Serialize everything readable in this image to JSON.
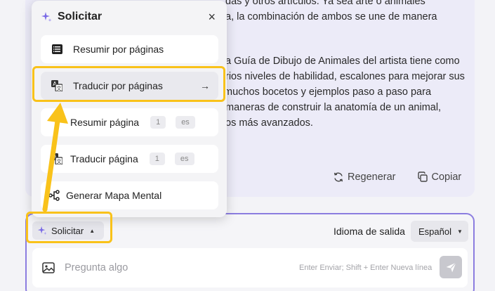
{
  "answer": {
    "lines": [
      "das y otros artículos. Ya sea arte o animales",
      "a, la combinación de ambos se une de manera",
      "",
      "a Guía de Dibujo de Animales del artista tiene como",
      "rios niveles de habilidad, escalones para mejorar sus",
      "muchos bocetos y ejemplos paso a paso para",
      "maneras de construir la anatomía de un animal,",
      "os más avanzados."
    ],
    "regenerate_label": "Regenerar",
    "copy_label": "Copiar"
  },
  "dropdown": {
    "title": "Solicitar",
    "close_label": "×",
    "items": [
      {
        "label": "Resumir por páginas",
        "icon": "list-icon"
      },
      {
        "label": "Traducir por páginas",
        "icon": "translate-icon",
        "arrow": "→"
      },
      {
        "label": "Resumir página",
        "icon": "list-icon",
        "page": "1",
        "lang": "es"
      },
      {
        "label": "Traducir página",
        "icon": "translate-icon",
        "page": "1",
        "lang": "es"
      },
      {
        "label": "Generar Mapa Mental",
        "icon": "mind-map-icon"
      }
    ]
  },
  "input": {
    "solicitar_label": "Solicitar",
    "output_language_label": "Idioma de salida",
    "output_language_value": "Español",
    "placeholder": "Pregunta algo",
    "hint": "Enter Enviar; Shift + Enter Nueva línea"
  },
  "colors": {
    "highlight": "#f9c21a",
    "accent": "#8b7de0",
    "sparkle": "#7b6be6"
  }
}
